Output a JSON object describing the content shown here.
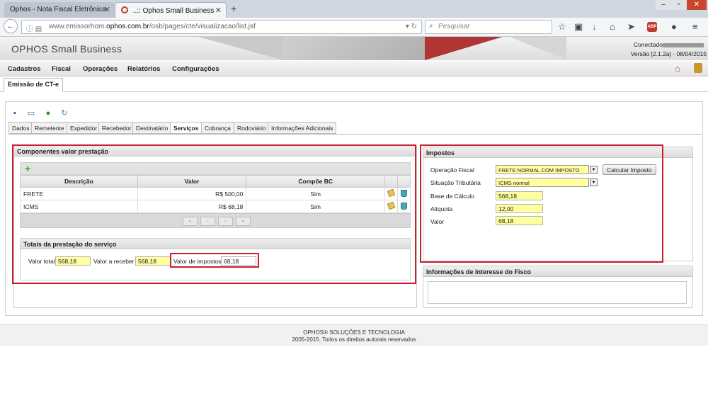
{
  "browser": {
    "tabs": [
      {
        "label": "Ophos - Nota Fiscal Eletrônica"
      },
      {
        "label": "..:: Ophos Small Business"
      }
    ],
    "url_prefix": "www.emissorhom.",
    "url_domain": "ophos.com.br",
    "url_path": "/osb/pages/cte/visualizacao/list.jsf",
    "search_placeholder": "Pesquisar",
    "addon_badge": "ABP"
  },
  "app": {
    "title": "OPHOS Small Business",
    "connected_label": "Conectado",
    "version": "Versão [2.1.2a] - 08/04/2015"
  },
  "menu": [
    "Cadastros",
    "Fiscal",
    "Operações",
    "Relatórios",
    "Configurações"
  ],
  "page_tab": "Emissão de CT-e",
  "subtabs": [
    "Dados",
    "Remetente",
    "Expedidor",
    "Recebedor",
    "Destinatário",
    "Serviços",
    "Cobrança",
    "Rodoviário",
    "Informações Adicionais"
  ],
  "active_subtab": "Serviços",
  "componentes": {
    "title": "Componentes valor prestação",
    "columns": [
      "Descrição",
      "Valor",
      "Compõe BC"
    ],
    "rows": [
      {
        "descricao": "FRETE",
        "valor": "R$ 500,00",
        "compoe": "Sim"
      },
      {
        "descricao": "ICMS",
        "valor": "R$ 68,18",
        "compoe": "Sim"
      }
    ],
    "pager": [
      "«",
      "‹",
      "›",
      "»"
    ]
  },
  "totais": {
    "title": "Totais da prestação do serviço",
    "valor_total_label": "Valor total",
    "valor_total": "568,18",
    "valor_receber_label": "Valor a receber",
    "valor_receber": "568,18",
    "valor_impostos_label": "Valor de impostos",
    "valor_impostos": "68,18"
  },
  "impostos": {
    "title": "Impostos",
    "operacao_label": "Operação Fiscal",
    "operacao_value": "FRETE NORMAL COM IMPOSTO",
    "calc_button": "Calcular Imposto",
    "situacao_label": "Situação Tributária",
    "situacao_value": "ICMS normal",
    "base_label": "Base de Cálculo",
    "base_value": "568,18",
    "aliquota_label": "Alíquota",
    "aliquota_value": "12,00",
    "valor_label": "Valor",
    "valor_value": "68,18"
  },
  "fisco": {
    "title": "Informações de Interesse do Fisco"
  },
  "footer": {
    "line1": "OPHOS® SOLUÇÕES E TECNOLOGIA",
    "line2": "2005-2015. Todos os direitos autorais reservados"
  },
  "colors": {
    "highlight_border": "#c8202e",
    "input_yellow": "#ffffa0",
    "add_green": "#3fa12b"
  }
}
